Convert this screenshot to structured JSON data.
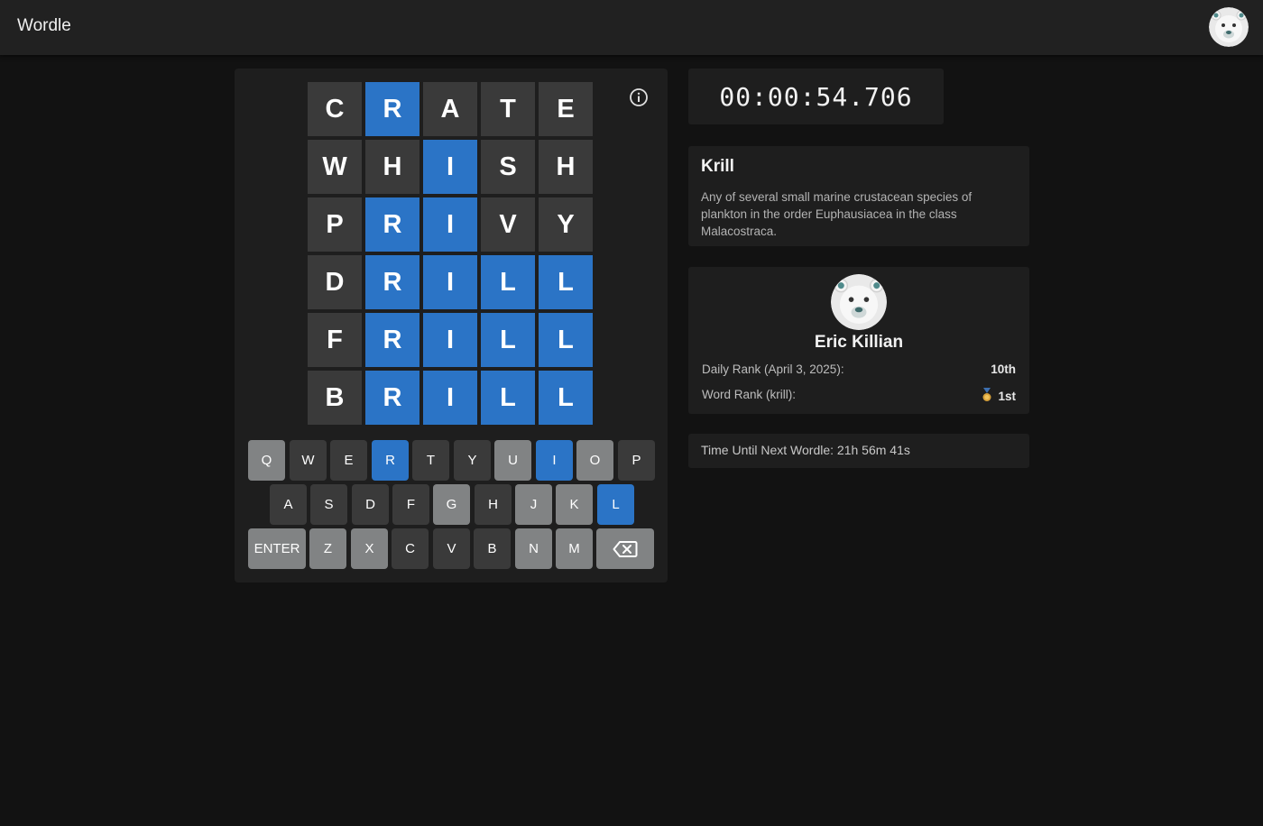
{
  "app": {
    "title": "Wordle"
  },
  "board": {
    "rows": [
      [
        {
          "l": "C",
          "s": "absent"
        },
        {
          "l": "R",
          "s": "correct"
        },
        {
          "l": "A",
          "s": "absent"
        },
        {
          "l": "T",
          "s": "absent"
        },
        {
          "l": "E",
          "s": "absent"
        }
      ],
      [
        {
          "l": "W",
          "s": "absent"
        },
        {
          "l": "H",
          "s": "absent"
        },
        {
          "l": "I",
          "s": "correct"
        },
        {
          "l": "S",
          "s": "absent"
        },
        {
          "l": "H",
          "s": "absent"
        }
      ],
      [
        {
          "l": "P",
          "s": "absent"
        },
        {
          "l": "R",
          "s": "correct"
        },
        {
          "l": "I",
          "s": "correct"
        },
        {
          "l": "V",
          "s": "absent"
        },
        {
          "l": "Y",
          "s": "absent"
        }
      ],
      [
        {
          "l": "D",
          "s": "absent"
        },
        {
          "l": "R",
          "s": "correct"
        },
        {
          "l": "I",
          "s": "correct"
        },
        {
          "l": "L",
          "s": "correct"
        },
        {
          "l": "L",
          "s": "correct"
        }
      ],
      [
        {
          "l": "F",
          "s": "absent"
        },
        {
          "l": "R",
          "s": "correct"
        },
        {
          "l": "I",
          "s": "correct"
        },
        {
          "l": "L",
          "s": "correct"
        },
        {
          "l": "L",
          "s": "correct"
        }
      ],
      [
        {
          "l": "B",
          "s": "absent"
        },
        {
          "l": "R",
          "s": "correct"
        },
        {
          "l": "I",
          "s": "correct"
        },
        {
          "l": "L",
          "s": "correct"
        },
        {
          "l": "L",
          "s": "correct"
        }
      ]
    ]
  },
  "keyboard": {
    "rows": [
      [
        {
          "k": "Q",
          "s": "absent"
        },
        {
          "k": "W",
          "s": "unused"
        },
        {
          "k": "E",
          "s": "unused"
        },
        {
          "k": "R",
          "s": "correct"
        },
        {
          "k": "T",
          "s": "unused"
        },
        {
          "k": "Y",
          "s": "unused"
        },
        {
          "k": "U",
          "s": "absent"
        },
        {
          "k": "I",
          "s": "correct"
        },
        {
          "k": "O",
          "s": "absent"
        },
        {
          "k": "P",
          "s": "unused"
        }
      ],
      [
        {
          "k": "A",
          "s": "unused"
        },
        {
          "k": "S",
          "s": "unused"
        },
        {
          "k": "D",
          "s": "unused"
        },
        {
          "k": "F",
          "s": "unused"
        },
        {
          "k": "G",
          "s": "absent"
        },
        {
          "k": "H",
          "s": "unused"
        },
        {
          "k": "J",
          "s": "absent"
        },
        {
          "k": "K",
          "s": "absent"
        },
        {
          "k": "L",
          "s": "correct"
        }
      ],
      [
        {
          "k": "ENTER",
          "s": "absent"
        },
        {
          "k": "Z",
          "s": "absent"
        },
        {
          "k": "X",
          "s": "absent"
        },
        {
          "k": "C",
          "s": "unused"
        },
        {
          "k": "V",
          "s": "unused"
        },
        {
          "k": "B",
          "s": "unused"
        },
        {
          "k": "N",
          "s": "absent"
        },
        {
          "k": "M",
          "s": "absent"
        },
        {
          "k": "",
          "s": "absent",
          "icon": "backspace-icon"
        }
      ]
    ]
  },
  "timer": {
    "value": "00:00:54.706"
  },
  "word": {
    "title": "Krill",
    "definition": "Any of several small marine crustacean species of plankton in the order Euphausiacea in the class Malacostraca."
  },
  "profile": {
    "name": "Eric Killian",
    "daily_rank_label": "Daily Rank (April 3, 2025):",
    "daily_rank_value": "10th",
    "word_rank_label": "Word Rank (krill):",
    "word_rank_value": "1st",
    "medal_icon": "medal-icon"
  },
  "next": {
    "text": "Time Until Next Wordle: 21h 56m 41s"
  },
  "colors": {
    "correct": "#2b74c6",
    "absent_key": "#818384",
    "tile": "#3a3a3a",
    "background": "#121212"
  }
}
